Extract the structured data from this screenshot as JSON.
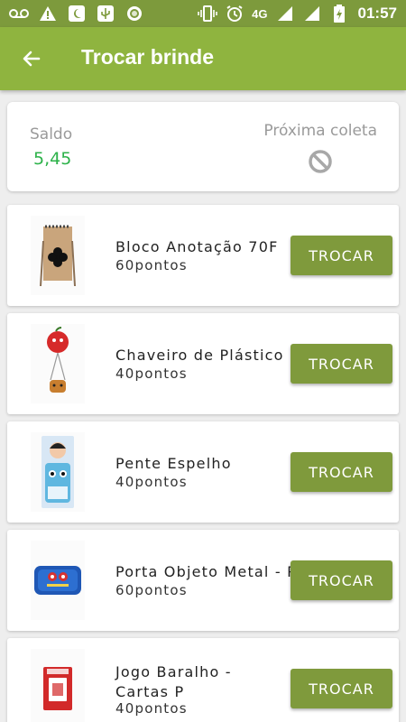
{
  "status_bar": {
    "network": "4G",
    "time": "01:57",
    "left_icons": [
      "voicemail-icon",
      "warning-icon",
      "night-mode-icon",
      "usb-icon",
      "record-icon"
    ],
    "right_icons": [
      "vibrate-icon",
      "alarm-icon",
      "signal-icon",
      "signal-icon",
      "battery-charging-icon"
    ]
  },
  "app_bar": {
    "title": "Trocar brinde",
    "back_icon": "arrow-back-icon",
    "color": "#8fb43f"
  },
  "balance": {
    "saldo_label": "Saldo",
    "saldo_value": "5,45",
    "proxima_coleta_label": "Próxima coleta",
    "proxima_coleta_icon": "blocked-icon",
    "saldo_color": "#2db24a"
  },
  "items": [
    {
      "name": "Bloco Anotação 70F",
      "points": "60pontos",
      "button": "TROCAR",
      "image_icon": "notepad-icon"
    },
    {
      "name": "Chaveiro de Plástico",
      "points": "40pontos",
      "button": "TROCAR",
      "image_icon": "keychain-icon"
    },
    {
      "name": "Pente Espelho",
      "points": "40pontos",
      "button": "TROCAR",
      "image_icon": "comb-mirror-icon"
    },
    {
      "name": "Porta Objeto Metal - P",
      "points": "60pontos",
      "button": "TROCAR",
      "image_icon": "metal-case-icon"
    },
    {
      "name": "Jogo Baralho - Cartas P",
      "points": "40pontos",
      "button": "TROCAR",
      "image_icon": "playing-cards-icon"
    }
  ],
  "colors": {
    "button": "#7f9a3c",
    "status_bar": "#7d9a3c"
  }
}
